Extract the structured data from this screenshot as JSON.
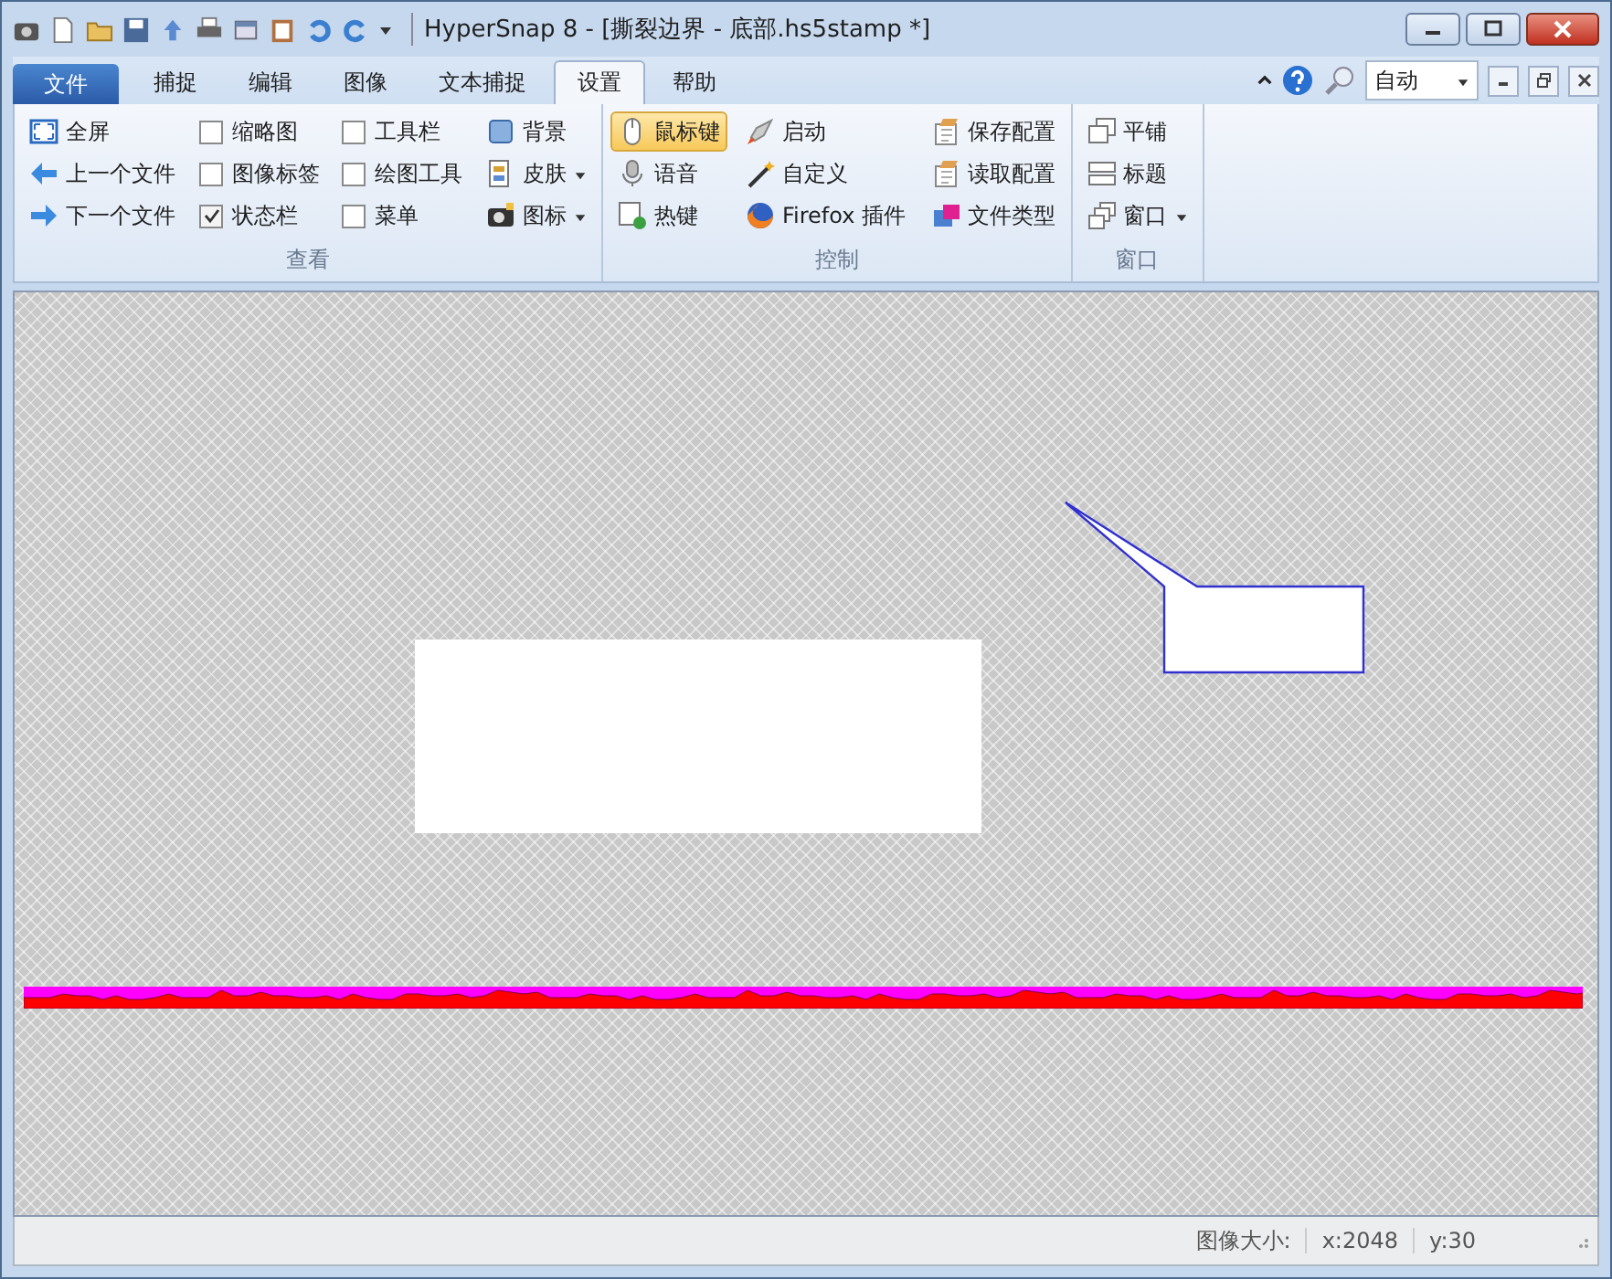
{
  "window": {
    "title": "HyperSnap 8 - [撕裂边界 - 底部.hs5stamp *]"
  },
  "tabs": [
    {
      "label": "文件",
      "kind": "file",
      "selected": false
    },
    {
      "label": "捕捉",
      "kind": "tab",
      "selected": false
    },
    {
      "label": "编辑",
      "kind": "tab",
      "selected": false
    },
    {
      "label": "图像",
      "kind": "tab",
      "selected": false
    },
    {
      "label": "文本捕捉",
      "kind": "tab",
      "selected": false
    },
    {
      "label": "设置",
      "kind": "tab",
      "selected": true
    },
    {
      "label": "帮助",
      "kind": "tab",
      "selected": false
    }
  ],
  "zoom_combo": {
    "value": "自动"
  },
  "ribbon": [
    {
      "label": "查看",
      "columns": [
        [
          {
            "kind": "button",
            "label": "全屏",
            "pressed": false
          },
          {
            "kind": "button",
            "label": "上一个文件",
            "pressed": false
          },
          {
            "kind": "button",
            "label": "下一个文件",
            "pressed": false
          }
        ],
        [
          {
            "kind": "checkbox",
            "label": "缩略图",
            "checked": false
          },
          {
            "kind": "checkbox",
            "label": "图像标签",
            "checked": false
          },
          {
            "kind": "checkbox",
            "label": "状态栏",
            "checked": true
          }
        ],
        [
          {
            "kind": "checkbox",
            "label": "工具栏",
            "checked": false
          },
          {
            "kind": "checkbox",
            "label": "绘图工具",
            "checked": false
          },
          {
            "kind": "checkbox",
            "label": "菜单",
            "checked": false
          }
        ],
        [
          {
            "kind": "button",
            "label": "背景",
            "pressed": false
          },
          {
            "kind": "menu",
            "label": "皮肤",
            "pressed": false
          },
          {
            "kind": "menu",
            "label": "图标",
            "pressed": false
          }
        ]
      ]
    },
    {
      "label": "控制",
      "columns": [
        [
          {
            "kind": "button",
            "label": "鼠标键",
            "pressed": true
          },
          {
            "kind": "button",
            "label": "语音",
            "pressed": false
          },
          {
            "kind": "button",
            "label": "热键",
            "pressed": false
          }
        ],
        [
          {
            "kind": "button",
            "label": "启动",
            "pressed": false
          },
          {
            "kind": "button",
            "label": "自定义",
            "pressed": false
          },
          {
            "kind": "button",
            "label": "Firefox 插件",
            "pressed": false
          }
        ],
        [
          {
            "kind": "button",
            "label": "保存配置",
            "pressed": false
          },
          {
            "kind": "button",
            "label": "读取配置",
            "pressed": false
          },
          {
            "kind": "button",
            "label": "文件类型",
            "pressed": false
          }
        ]
      ]
    },
    {
      "label": "窗口",
      "columns": [
        [
          {
            "kind": "button",
            "label": "平铺",
            "pressed": false
          },
          {
            "kind": "button",
            "label": "标题",
            "pressed": false
          },
          {
            "kind": "menu",
            "label": "窗口",
            "pressed": false
          }
        ]
      ]
    }
  ],
  "status_bar": {
    "items": [
      "图像大小:",
      "x:2048",
      "y:30"
    ]
  }
}
